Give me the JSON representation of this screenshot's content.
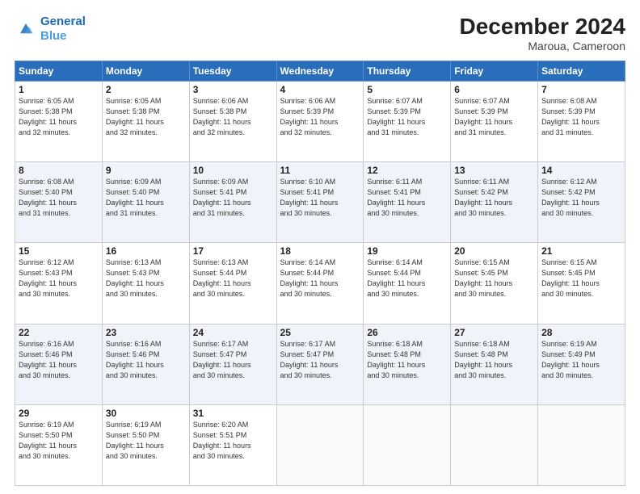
{
  "logo": {
    "line1": "General",
    "line2": "Blue"
  },
  "title": "December 2024",
  "subtitle": "Maroua, Cameroon",
  "days_header": [
    "Sunday",
    "Monday",
    "Tuesday",
    "Wednesday",
    "Thursday",
    "Friday",
    "Saturday"
  ],
  "weeks": [
    [
      {
        "day": "1",
        "info": "Sunrise: 6:05 AM\nSunset: 5:38 PM\nDaylight: 11 hours\nand 32 minutes."
      },
      {
        "day": "2",
        "info": "Sunrise: 6:05 AM\nSunset: 5:38 PM\nDaylight: 11 hours\nand 32 minutes."
      },
      {
        "day": "3",
        "info": "Sunrise: 6:06 AM\nSunset: 5:38 PM\nDaylight: 11 hours\nand 32 minutes."
      },
      {
        "day": "4",
        "info": "Sunrise: 6:06 AM\nSunset: 5:39 PM\nDaylight: 11 hours\nand 32 minutes."
      },
      {
        "day": "5",
        "info": "Sunrise: 6:07 AM\nSunset: 5:39 PM\nDaylight: 11 hours\nand 31 minutes."
      },
      {
        "day": "6",
        "info": "Sunrise: 6:07 AM\nSunset: 5:39 PM\nDaylight: 11 hours\nand 31 minutes."
      },
      {
        "day": "7",
        "info": "Sunrise: 6:08 AM\nSunset: 5:39 PM\nDaylight: 11 hours\nand 31 minutes."
      }
    ],
    [
      {
        "day": "8",
        "info": "Sunrise: 6:08 AM\nSunset: 5:40 PM\nDaylight: 11 hours\nand 31 minutes."
      },
      {
        "day": "9",
        "info": "Sunrise: 6:09 AM\nSunset: 5:40 PM\nDaylight: 11 hours\nand 31 minutes."
      },
      {
        "day": "10",
        "info": "Sunrise: 6:09 AM\nSunset: 5:41 PM\nDaylight: 11 hours\nand 31 minutes."
      },
      {
        "day": "11",
        "info": "Sunrise: 6:10 AM\nSunset: 5:41 PM\nDaylight: 11 hours\nand 30 minutes."
      },
      {
        "day": "12",
        "info": "Sunrise: 6:11 AM\nSunset: 5:41 PM\nDaylight: 11 hours\nand 30 minutes."
      },
      {
        "day": "13",
        "info": "Sunrise: 6:11 AM\nSunset: 5:42 PM\nDaylight: 11 hours\nand 30 minutes."
      },
      {
        "day": "14",
        "info": "Sunrise: 6:12 AM\nSunset: 5:42 PM\nDaylight: 11 hours\nand 30 minutes."
      }
    ],
    [
      {
        "day": "15",
        "info": "Sunrise: 6:12 AM\nSunset: 5:43 PM\nDaylight: 11 hours\nand 30 minutes."
      },
      {
        "day": "16",
        "info": "Sunrise: 6:13 AM\nSunset: 5:43 PM\nDaylight: 11 hours\nand 30 minutes."
      },
      {
        "day": "17",
        "info": "Sunrise: 6:13 AM\nSunset: 5:44 PM\nDaylight: 11 hours\nand 30 minutes."
      },
      {
        "day": "18",
        "info": "Sunrise: 6:14 AM\nSunset: 5:44 PM\nDaylight: 11 hours\nand 30 minutes."
      },
      {
        "day": "19",
        "info": "Sunrise: 6:14 AM\nSunset: 5:44 PM\nDaylight: 11 hours\nand 30 minutes."
      },
      {
        "day": "20",
        "info": "Sunrise: 6:15 AM\nSunset: 5:45 PM\nDaylight: 11 hours\nand 30 minutes."
      },
      {
        "day": "21",
        "info": "Sunrise: 6:15 AM\nSunset: 5:45 PM\nDaylight: 11 hours\nand 30 minutes."
      }
    ],
    [
      {
        "day": "22",
        "info": "Sunrise: 6:16 AM\nSunset: 5:46 PM\nDaylight: 11 hours\nand 30 minutes."
      },
      {
        "day": "23",
        "info": "Sunrise: 6:16 AM\nSunset: 5:46 PM\nDaylight: 11 hours\nand 30 minutes."
      },
      {
        "day": "24",
        "info": "Sunrise: 6:17 AM\nSunset: 5:47 PM\nDaylight: 11 hours\nand 30 minutes."
      },
      {
        "day": "25",
        "info": "Sunrise: 6:17 AM\nSunset: 5:47 PM\nDaylight: 11 hours\nand 30 minutes."
      },
      {
        "day": "26",
        "info": "Sunrise: 6:18 AM\nSunset: 5:48 PM\nDaylight: 11 hours\nand 30 minutes."
      },
      {
        "day": "27",
        "info": "Sunrise: 6:18 AM\nSunset: 5:48 PM\nDaylight: 11 hours\nand 30 minutes."
      },
      {
        "day": "28",
        "info": "Sunrise: 6:19 AM\nSunset: 5:49 PM\nDaylight: 11 hours\nand 30 minutes."
      }
    ],
    [
      {
        "day": "29",
        "info": "Sunrise: 6:19 AM\nSunset: 5:50 PM\nDaylight: 11 hours\nand 30 minutes."
      },
      {
        "day": "30",
        "info": "Sunrise: 6:19 AM\nSunset: 5:50 PM\nDaylight: 11 hours\nand 30 minutes."
      },
      {
        "day": "31",
        "info": "Sunrise: 6:20 AM\nSunset: 5:51 PM\nDaylight: 11 hours\nand 30 minutes."
      },
      {
        "day": "",
        "info": ""
      },
      {
        "day": "",
        "info": ""
      },
      {
        "day": "",
        "info": ""
      },
      {
        "day": "",
        "info": ""
      }
    ]
  ]
}
